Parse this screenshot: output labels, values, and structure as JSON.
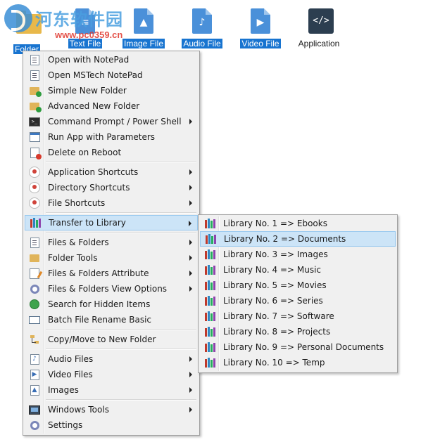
{
  "desktop": {
    "icons": [
      {
        "label": "Folder",
        "selected": true,
        "icon": "folder-icon"
      },
      {
        "label": "Text File",
        "selected": true,
        "icon": "text-file-icon"
      },
      {
        "label": "Image File",
        "selected": true,
        "icon": "image-file-icon"
      },
      {
        "label": "Audio File",
        "selected": true,
        "icon": "audio-file-icon"
      },
      {
        "label": "Video File",
        "selected": true,
        "icon": "video-file-icon"
      },
      {
        "label": "Application",
        "selected": false,
        "icon": "code-icon"
      }
    ]
  },
  "watermark": {
    "site_name": "河东软件园",
    "url": "www.pc0359.cn"
  },
  "context_menu": {
    "items": [
      {
        "label": "Open with NotePad",
        "icon": "notepad-icon",
        "submenu": false
      },
      {
        "label": "Open MSTech NotePad",
        "icon": "notepad-icon",
        "submenu": false
      },
      {
        "label": "Simple New Folder",
        "icon": "new-folder-icon",
        "submenu": false
      },
      {
        "label": "Advanced New Folder",
        "icon": "new-folder-icon",
        "submenu": false
      },
      {
        "label": "Command Prompt / Power Shell",
        "icon": "terminal-icon",
        "submenu": true
      },
      {
        "label": "Run App with Parameters",
        "icon": "run-app-icon",
        "submenu": false
      },
      {
        "label": "Delete on Reboot",
        "icon": "delete-file-icon",
        "submenu": false
      },
      {
        "label": "Application Shortcuts",
        "icon": "pin-icon",
        "submenu": true
      },
      {
        "label": "Directory Shortcuts",
        "icon": "pin-icon",
        "submenu": true
      },
      {
        "label": "File Shortcuts",
        "icon": "pin-icon",
        "submenu": true
      },
      {
        "label": "Transfer to Library",
        "icon": "library-icon",
        "submenu": true,
        "highlighted": true
      },
      {
        "label": "Files & Folders",
        "icon": "file-icon",
        "submenu": true
      },
      {
        "label": "Folder Tools",
        "icon": "folder-icon",
        "submenu": true
      },
      {
        "label": "Files & Folders Attribute",
        "icon": "attribute-icon",
        "submenu": true
      },
      {
        "label": "Files & Folders View Options",
        "icon": "gear-icon",
        "submenu": true
      },
      {
        "label": "Search for Hidden Items",
        "icon": "search-icon",
        "submenu": false
      },
      {
        "label": "Batch File Rename Basic",
        "icon": "rename-icon",
        "submenu": false
      },
      {
        "label": "Copy/Move to New Folder",
        "icon": "folder-tree-icon",
        "submenu": false
      },
      {
        "label": "Audio Files",
        "icon": "audio-file-icon",
        "submenu": true
      },
      {
        "label": "Video Files",
        "icon": "video-file-icon",
        "submenu": true
      },
      {
        "label": "Images",
        "icon": "image-file-icon",
        "submenu": true
      },
      {
        "label": "Windows Tools",
        "icon": "windows-icon",
        "submenu": true
      },
      {
        "label": "Settings",
        "icon": "gear-icon",
        "submenu": false
      }
    ]
  },
  "library_submenu": {
    "items": [
      {
        "label": "Library No. 1 => Ebooks"
      },
      {
        "label": "Library No. 2 => Documents",
        "highlighted": true
      },
      {
        "label": "Library No. 3 => Images"
      },
      {
        "label": "Library No. 4 => Music"
      },
      {
        "label": "Library No. 5 => Movies"
      },
      {
        "label": "Library No. 6 => Series"
      },
      {
        "label": "Library No. 7 => Software"
      },
      {
        "label": "Library No. 8 => Projects"
      },
      {
        "label": "Library No. 9 => Personal Documents"
      },
      {
        "label": "Library No. 10 => Temp"
      }
    ]
  },
  "colors": {
    "selection_blue": "#1874d0",
    "menu_bg": "#f0f0f0",
    "highlight": "#cce4f7",
    "highlight_border": "#99c9ef"
  }
}
